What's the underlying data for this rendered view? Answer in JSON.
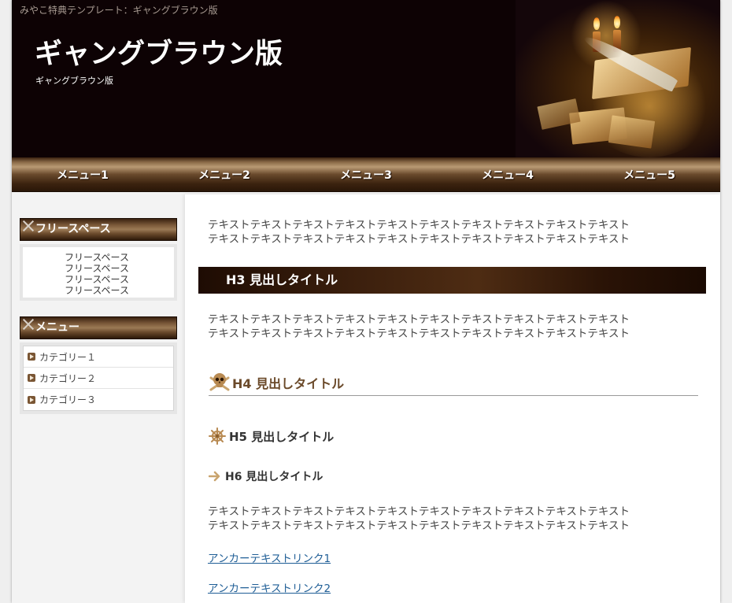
{
  "header": {
    "top_strip": "みやこ特典テンプレート：ギャングブラウン版",
    "title": "ギャングブラウン版",
    "subtitle": "ギャングブラウン版"
  },
  "nav": {
    "items": [
      "メニュー1",
      "メニュー2",
      "メニュー3",
      "メニュー4",
      "メニュー5"
    ]
  },
  "sidebar": {
    "free_space": {
      "title": "フリースペース",
      "lines": [
        "フリースペース",
        "フリースペース",
        "フリースペース",
        "フリースペース"
      ]
    },
    "menu": {
      "title": "メニュー",
      "items": [
        "カテゴリー１",
        "カテゴリー２",
        "カテゴリー３"
      ]
    }
  },
  "main": {
    "para1": [
      "テキストテキストテキストテキストテキストテキストテキストテキストテキストテキスト",
      "テキストテキストテキストテキストテキストテキストテキストテキストテキストテキスト"
    ],
    "h3": "H3 見出しタイトル",
    "para2": [
      "テキストテキストテキストテキストテキストテキストテキストテキストテキストテキスト",
      "テキストテキストテキストテキストテキストテキストテキストテキストテキストテキスト"
    ],
    "h4": "H4 見出しタイトル",
    "h5": "H5 見出しタイトル",
    "h6": "H6 見出しタイトル",
    "para3": [
      "テキストテキストテキストテキストテキストテキストテキストテキストテキストテキスト",
      "テキストテキストテキストテキストテキストテキストテキストテキストテキストテキスト"
    ],
    "links": [
      "アンカーテキストリンク1",
      "アンカーテキストリンク2"
    ]
  },
  "colors": {
    "header_bg": "#0d0204",
    "accent_brown": "#6b4a2a",
    "link": "#1f5e96"
  },
  "icons": {
    "h4": "skull-crossbones-icon",
    "h5": "ship-wheel-icon",
    "h6": "arrow-right-icon",
    "sidebar_title": "cross-icon",
    "category": "play-bullet-icon"
  }
}
